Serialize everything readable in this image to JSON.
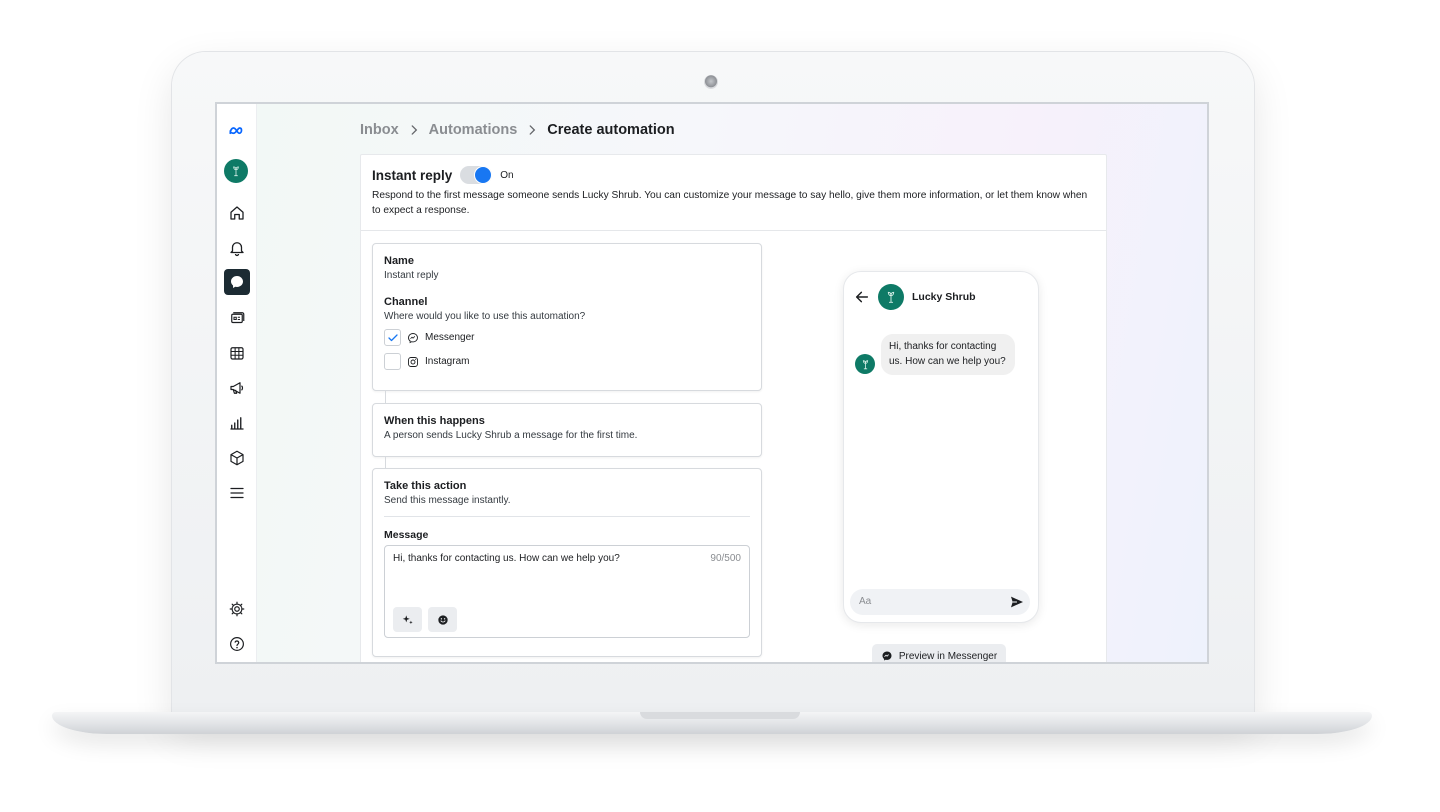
{
  "breadcrumb": {
    "items": [
      "Inbox",
      "Automations"
    ],
    "current": "Create automation"
  },
  "header": {
    "title": "Instant reply",
    "toggle_state": "On",
    "description": "Respond to the first message someone sends Lucky Shrub. You can customize your message to say hello, give them more information, or let them know when to expect a response."
  },
  "name_section": {
    "label": "Name",
    "value": "Instant reply"
  },
  "channel_section": {
    "label": "Channel",
    "question": "Where would you like to use this automation?",
    "options": [
      {
        "label": "Messenger",
        "checked": true
      },
      {
        "label": "Instagram",
        "checked": false
      }
    ]
  },
  "trigger_section": {
    "label": "When this happens",
    "description": "A person sends Lucky Shrub a message for the first time."
  },
  "action_section": {
    "label": "Take this action",
    "description": "Send this message instantly.",
    "message_label": "Message",
    "message_value": "Hi, thanks for contacting us. How can we help you?",
    "char_count": "90/500"
  },
  "preview": {
    "page_name": "Lucky Shrub",
    "bubble_text": "Hi, thanks for contacting us. How can we help you?",
    "composer_placeholder": "Aa",
    "button_label": "Preview in Messenger"
  },
  "nav": {
    "items": [
      "meta-logo-icon",
      "home-icon",
      "bell-icon",
      "inbox-icon",
      "content-icon",
      "planner-icon",
      "ads-icon",
      "insights-icon",
      "products-icon",
      "menu-icon",
      "settings-icon",
      "help-icon"
    ]
  },
  "colors": {
    "accent": "#1877f2",
    "brand_green": "#0e7a66",
    "active_nav": "#1c2b33"
  }
}
